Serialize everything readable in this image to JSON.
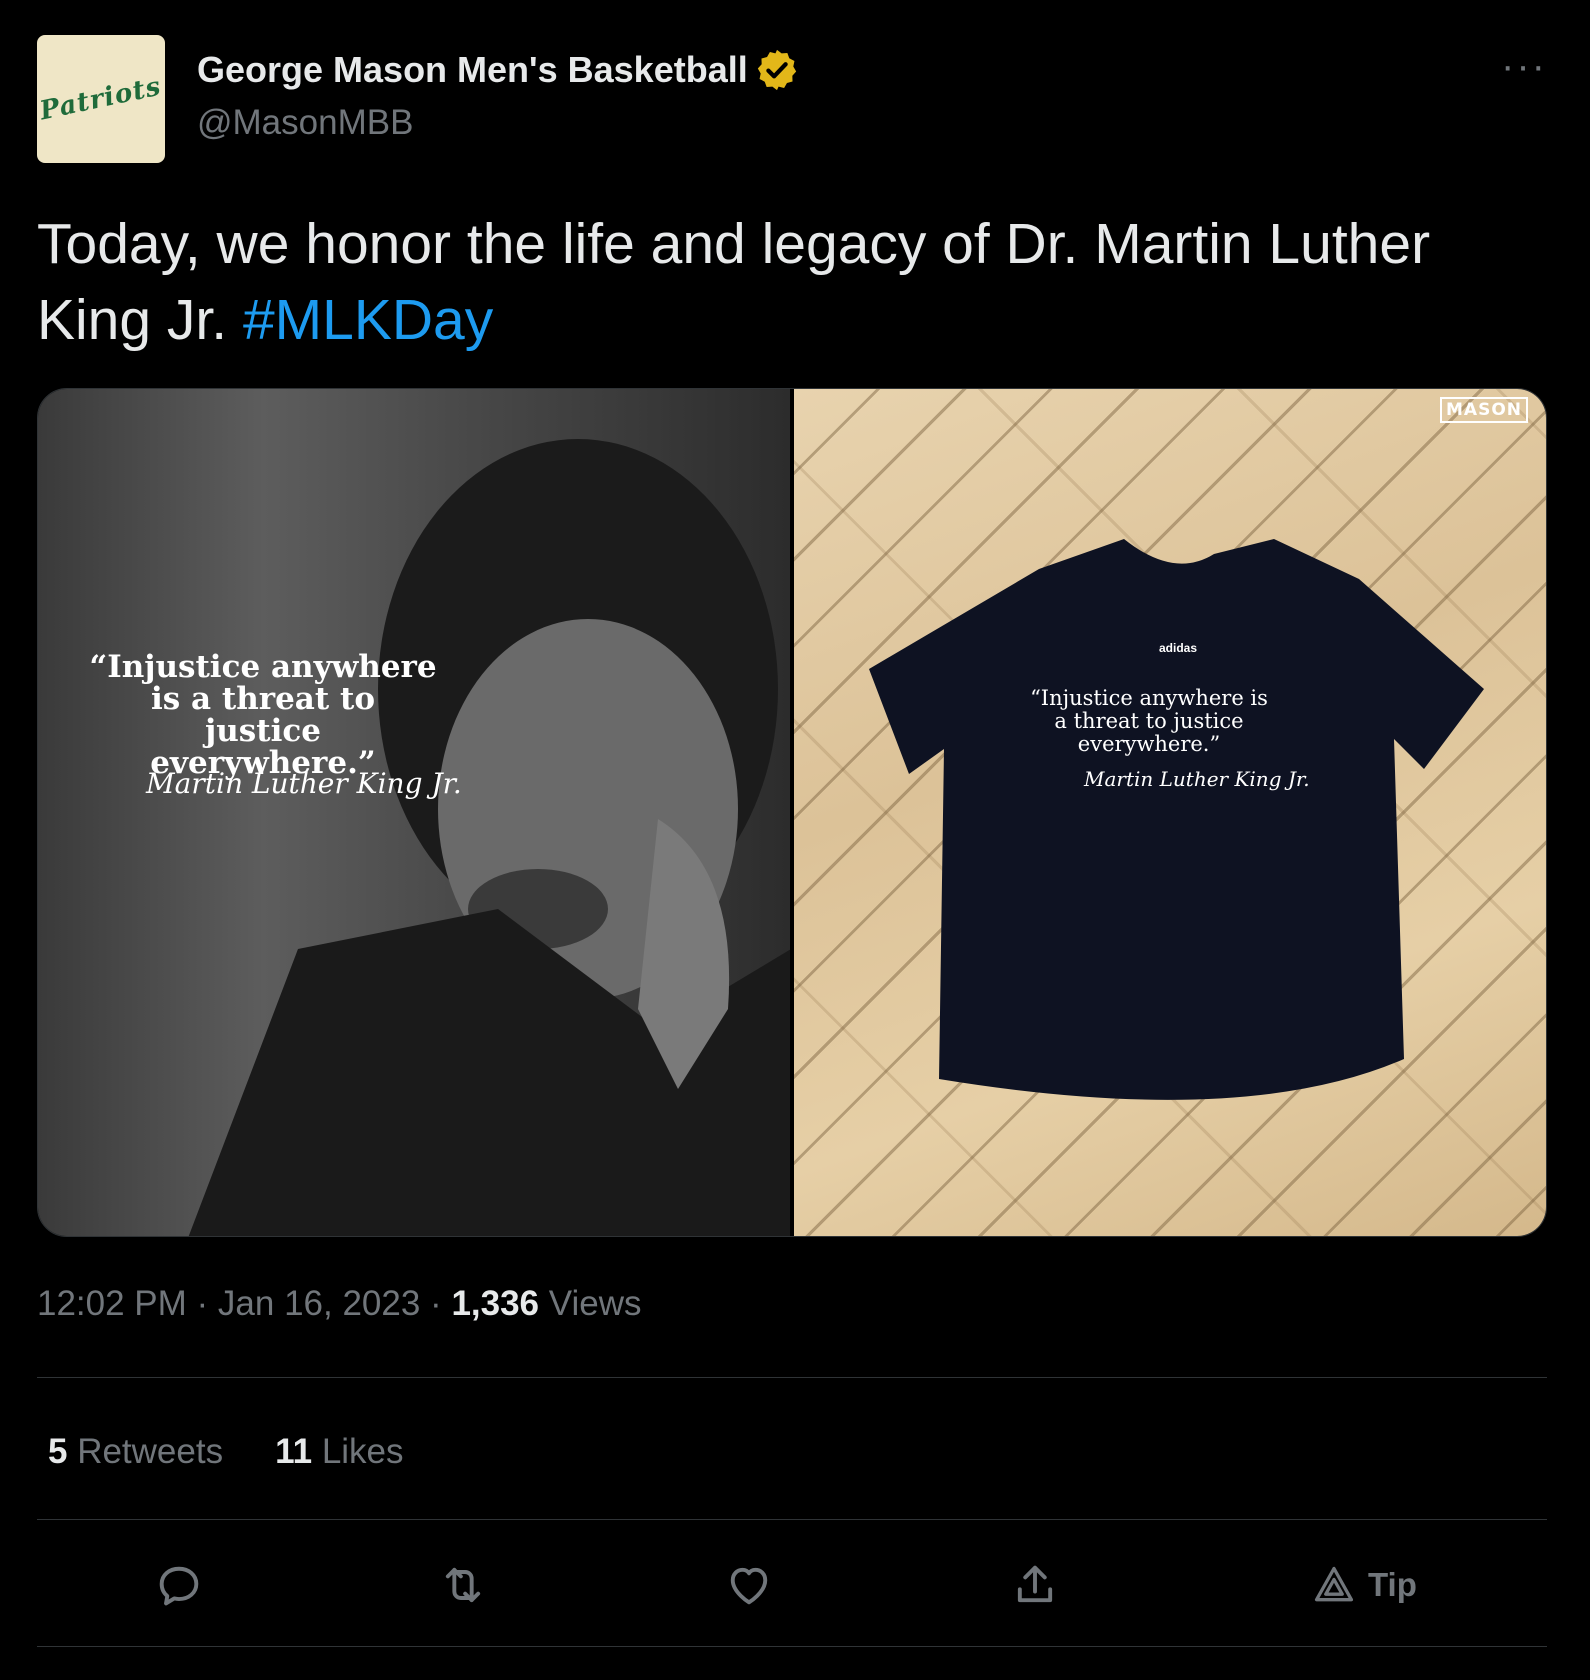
{
  "author": {
    "avatar_text": "Patriots",
    "display_name": "George Mason Men's Basketball",
    "handle": "@MasonMBB",
    "verified_color": "#e2b719"
  },
  "more_label": "···",
  "tweet": {
    "text": "Today, we honor the life and legacy of Dr. Martin Luther King Jr. ",
    "hashtag": "#MLKDay"
  },
  "media": {
    "left_quote": "“Injustice anywhere is a threat to justice everywhere.”",
    "left_signature": "Martin Luther King Jr.",
    "right_quote": "“Injustice anywhere is a threat to justice everywhere.”",
    "right_signature": "Martin Luther King Jr.",
    "logo_text": "MASON",
    "brand_text": "adidas"
  },
  "meta": {
    "time": "12:02 PM",
    "sep1": " · ",
    "date": "Jan 16, 2023",
    "sep2": " · ",
    "views_count": "1,336",
    "views_label": " Views"
  },
  "stats": {
    "retweets_count": "5",
    "retweets_label": " Retweets",
    "likes_count": "11",
    "likes_label": " Likes"
  },
  "actions": {
    "tip_label": "Tip"
  },
  "colors": {
    "background": "#000000",
    "text": "#e7e9ea",
    "secondary": "#71767b",
    "link": "#1d9bf0",
    "divider": "#2f3336"
  }
}
